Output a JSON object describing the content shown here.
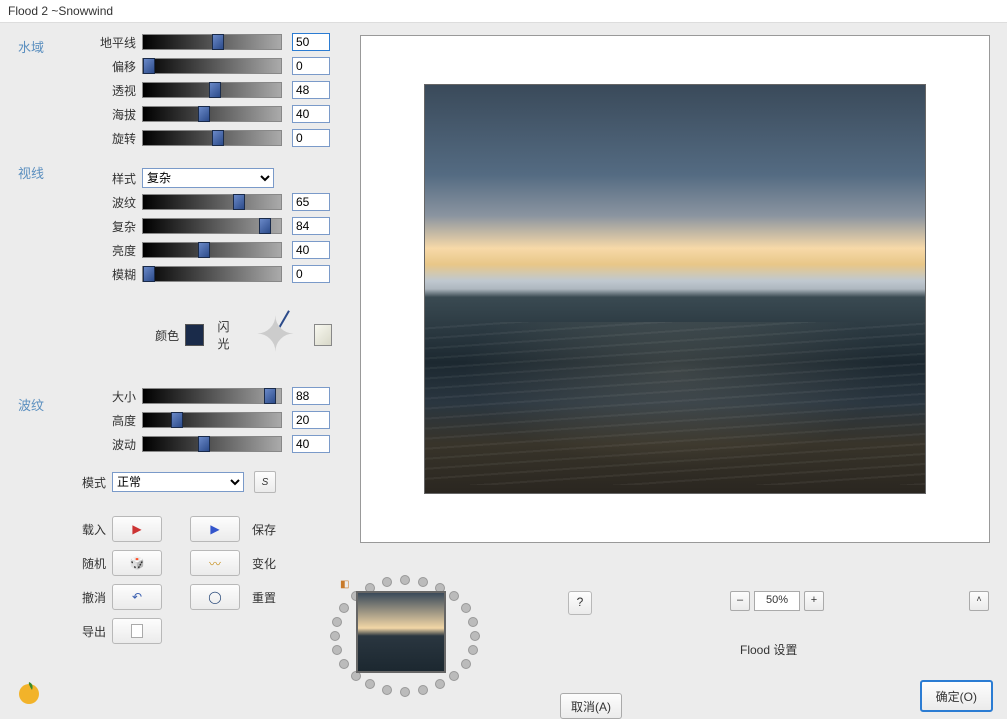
{
  "window": {
    "title": "Flood 2 ~Snowwind"
  },
  "sections": {
    "water": "水域",
    "view": "视线",
    "ripple": "波纹"
  },
  "sliders": {
    "horizon": {
      "label": "地平线",
      "value": "50",
      "pos": 50
    },
    "offset": {
      "label": "偏移",
      "value": "0",
      "pos": 0
    },
    "perspective": {
      "label": "透视",
      "value": "48",
      "pos": 48
    },
    "altitude": {
      "label": "海拔",
      "value": "40",
      "pos": 40
    },
    "rotation": {
      "label": "旋转",
      "value": "0",
      "pos": 50
    },
    "wave": {
      "label": "波纹",
      "value": "65",
      "pos": 65
    },
    "complexity": {
      "label": "复杂",
      "value": "84",
      "pos": 84
    },
    "brightness": {
      "label": "亮度",
      "value": "40",
      "pos": 40
    },
    "blur": {
      "label": "模糊",
      "value": "0",
      "pos": 0
    },
    "size": {
      "label": "大小",
      "value": "88",
      "pos": 88
    },
    "height": {
      "label": "高度",
      "value": "20",
      "pos": 20
    },
    "wobble": {
      "label": "波动",
      "value": "40",
      "pos": 40
    }
  },
  "style": {
    "label": "样式",
    "selected": "复杂"
  },
  "color": {
    "label": "颜色",
    "glare": "闪光",
    "hex": "#1a2b4a"
  },
  "mode": {
    "label": "模式",
    "selected": "正常",
    "s": "S"
  },
  "actions": {
    "load": "载入",
    "save": "保存",
    "random": "随机",
    "variation": "变化",
    "undo": "撤消",
    "reset": "重置",
    "export": "导出"
  },
  "zoom": {
    "value": "50%",
    "minus": "–",
    "plus": "+"
  },
  "help": "?",
  "caret": "˄",
  "settings_label": "Flood 设置",
  "footer": {
    "cancel": "取消(A)",
    "ok": "确定(O)"
  }
}
